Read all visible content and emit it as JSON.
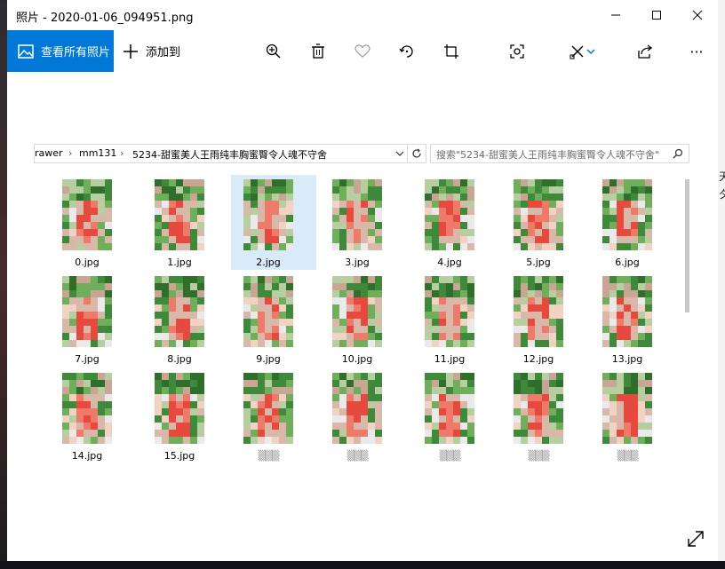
{
  "window": {
    "title": "照片 - 2020-01-06_094951.png",
    "controls": {
      "minimize": "—",
      "maximize": "☐",
      "close": "✕"
    }
  },
  "toolbar": {
    "see_all_label": "查看所有照片",
    "add_to_label": "添加到",
    "tools": [
      "zoom-in-icon",
      "delete-icon",
      "favorite-icon",
      "rotate-icon",
      "crop-icon",
      "enhance-icon",
      "edit-icon",
      "share-icon",
      "more-icon"
    ],
    "more_glyph": "···"
  },
  "explorer": {
    "breadcrumb": [
      "rawer",
      "mm131",
      "5234-甜蜜美人王雨纯丰胸蜜臀令人魂不守舍"
    ],
    "search_placeholder": "搜索\"5234-甜蜜美人王雨纯丰胸蜜臀令人魂不守舍\"",
    "files": [
      "0.jpg",
      "1.jpg",
      "2.jpg",
      "3.jpg",
      "4.jpg",
      "5.jpg",
      "6.jpg",
      "7.jpg",
      "8.jpg",
      "9.jpg",
      "10.jpg",
      "11.jpg",
      "12.jpg",
      "13.jpg",
      "14.jpg",
      "15.jpg"
    ],
    "selected_index": 2
  },
  "desktop": {
    "right_glyphs": [
      "天",
      "夕"
    ]
  },
  "colors": {
    "accent": "#0078d7",
    "selection": "#d9ebf9"
  }
}
